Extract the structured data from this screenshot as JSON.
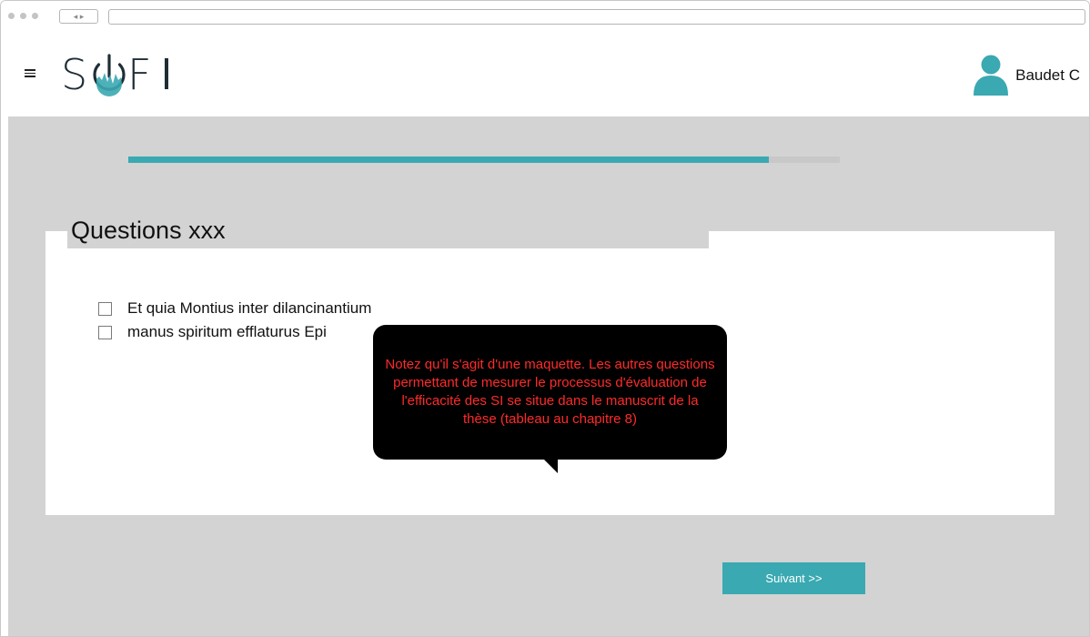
{
  "browser": {
    "nav_arrows": "◂ ▸"
  },
  "header": {
    "logo_text": "SOFI",
    "user_name": "Baudet C"
  },
  "progress": {
    "value_percent": 90
  },
  "questionnaire": {
    "title": "Questions xxx",
    "options": [
      {
        "label": "Et quia Montius inter dilancinantium",
        "checked": false
      },
      {
        "label": "manus spiritum efflaturus Epi",
        "checked": false
      }
    ]
  },
  "tooltip": {
    "text": "Notez qu'il s'agit d'une maquette. Les autres questions permettant de mesurer le processus d'évaluation de l'efficacité des SI se situe dans le manuscrit de la thèse (tableau au chapitre 8)"
  },
  "actions": {
    "next_label": "Suivant >>"
  },
  "colors": {
    "accent": "#3aa9b1",
    "background": "#d3d3d3",
    "tooltip_text": "#ff2a2a",
    "logo_dark": "#1f2e36"
  },
  "icons": {
    "menu": "hamburger-icon",
    "user": "user-avatar-icon",
    "logo_power": "power-icon"
  }
}
